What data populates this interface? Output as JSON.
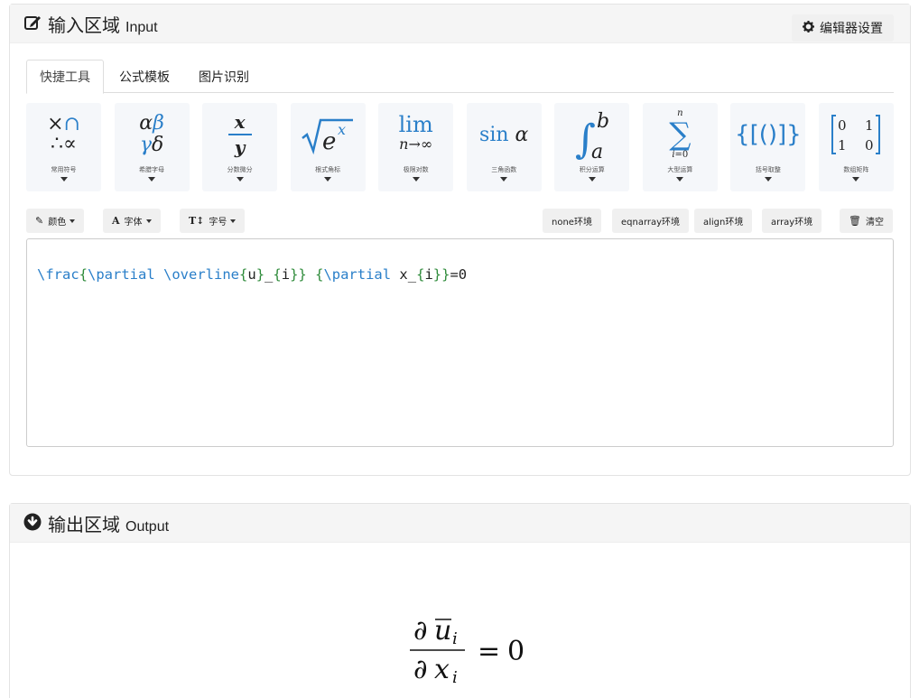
{
  "input_panel": {
    "title_cn": "输入区域",
    "title_en": "Input",
    "settings_label": "编辑器设置",
    "tabs": [
      {
        "label": "快捷工具",
        "active": true
      },
      {
        "label": "公式模板",
        "active": false
      },
      {
        "label": "图片识别",
        "active": false
      }
    ],
    "tools": [
      {
        "label": "常用符号",
        "icon": "common-symbols"
      },
      {
        "label": "希腊字母",
        "icon": "greek-letters"
      },
      {
        "label": "分数微分",
        "icon": "fraction"
      },
      {
        "label": "根式角标",
        "icon": "radical"
      },
      {
        "label": "极限对数",
        "icon": "limit"
      },
      {
        "label": "三角函数",
        "icon": "trig"
      },
      {
        "label": "积分运算",
        "icon": "integral"
      },
      {
        "label": "大型运算",
        "icon": "sum"
      },
      {
        "label": "括号取整",
        "icon": "brackets"
      },
      {
        "label": "数组矩阵",
        "icon": "matrix"
      }
    ],
    "toolbar": {
      "color_label": "颜色",
      "font_label": "字体",
      "size_label": "字号",
      "env_none": "none环境",
      "env_eqnarray": "eqnarray环境",
      "env_align": "align环境",
      "env_array": "array环境",
      "clear_label": "清空"
    },
    "editor_tokens": [
      {
        "t": "\\frac",
        "k": "cmd"
      },
      {
        "t": "{",
        "k": "br"
      },
      {
        "t": "\\partial",
        "k": "cmd"
      },
      {
        "t": " ",
        "k": "tx"
      },
      {
        "t": "\\overline",
        "k": "cmd"
      },
      {
        "t": "{",
        "k": "br"
      },
      {
        "t": "u",
        "k": "tx"
      },
      {
        "t": "}",
        "k": "br"
      },
      {
        "t": "_",
        "k": "tx"
      },
      {
        "t": "{",
        "k": "br"
      },
      {
        "t": "i",
        "k": "tx"
      },
      {
        "t": "}}",
        "k": "br"
      },
      {
        "t": " ",
        "k": "tx"
      },
      {
        "t": "{",
        "k": "br"
      },
      {
        "t": "\\partial",
        "k": "cmd"
      },
      {
        "t": " x",
        "k": "tx"
      },
      {
        "t": "_",
        "k": "tx"
      },
      {
        "t": "{",
        "k": "br"
      },
      {
        "t": "i",
        "k": "tx"
      },
      {
        "t": "}}",
        "k": "br"
      },
      {
        "t": "=0",
        "k": "tx"
      }
    ]
  },
  "output_panel": {
    "title_cn": "输出区域",
    "title_en": "Output",
    "formula": {
      "num_partial": "∂",
      "num_var": "u",
      "num_sub": "i",
      "den_partial": "∂",
      "den_var": "x",
      "den_sub": "i",
      "equals": "=",
      "rhs": "0"
    }
  },
  "colors": {
    "accent_blue": "#2a7fc9",
    "brace_green": "#2e8b3a",
    "header_bg": "#f5f5f5",
    "tool_bg": "#f5f7fa"
  }
}
